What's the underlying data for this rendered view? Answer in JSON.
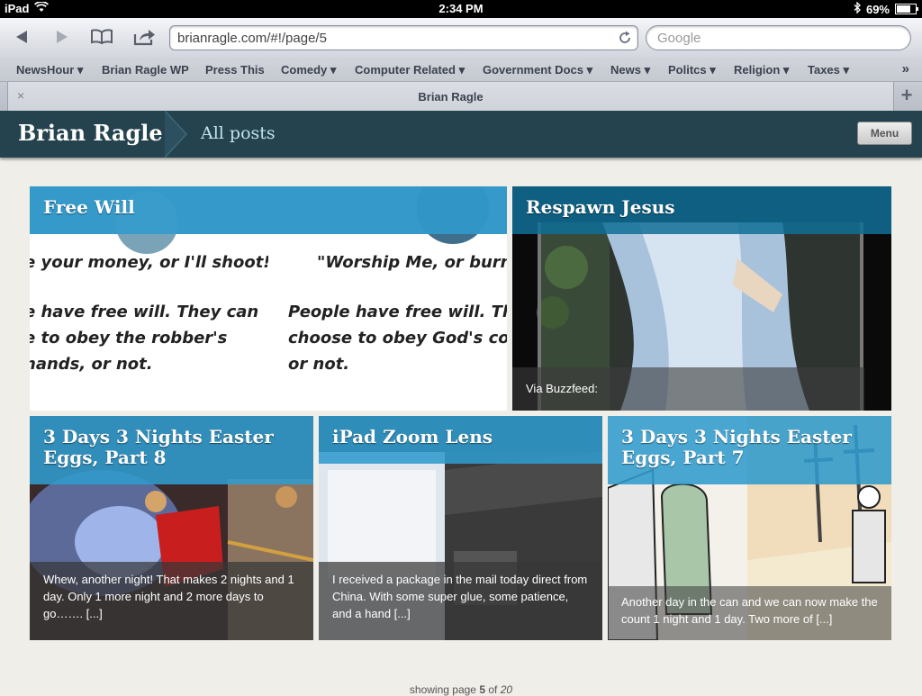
{
  "status_bar": {
    "device": "iPad",
    "time": "2:34 PM",
    "battery": "69%",
    "battery_level": 0.69
  },
  "browser": {
    "url": "brianragle.com/#!/page/5",
    "search_placeholder": "Google",
    "bookmarks": [
      {
        "label": "NewsHour ▾"
      },
      {
        "label": "Brian Ragle WP"
      },
      {
        "label": "Press This"
      },
      {
        "label": "Comedy ▾"
      },
      {
        "label": "Computer Related ▾"
      },
      {
        "label": "Government Docs ▾"
      },
      {
        "label": "News ▾"
      },
      {
        "label": "Politcs ▾"
      },
      {
        "label": "Religion ▾"
      },
      {
        "label": "Taxes ▾"
      }
    ],
    "bookmarks_more": "»",
    "tab_title": "Brian Ragle",
    "tab_close": "×",
    "tab_add": "+"
  },
  "site": {
    "brand": "Brian Ragle",
    "section": "All posts",
    "menu_label": "Menu"
  },
  "posts": [
    {
      "title": "Free Will",
      "excerpt": "",
      "thumb_text": {
        "col1": [
          "e your money, or I'll shoot!\"",
          "e have free will. They can",
          "e to obey the robber's",
          "nands, or not."
        ],
        "col2": [
          "\"Worship Me, or burn i",
          "People have free will. They",
          "choose to obey God's comn",
          "or not."
        ]
      }
    },
    {
      "title": "Respawn Jesus",
      "excerpt": "Via Buzzfeed:"
    },
    {
      "title": "3 Days 3 Nights Easter Eggs, Part 8",
      "excerpt": "Whew, another night!  That makes 2 nights and 1 day.  Only 1 more night and 2 more days to go……. [...]"
    },
    {
      "title": "iPad Zoom Lens",
      "excerpt": "I received a package in the mail today direct from China.  With some super glue, some patience, and a hand [...]"
    },
    {
      "title": "3 Days 3 Nights Easter Eggs, Part 7",
      "excerpt": "Another day in the can and we can now make the count 1 night and 1 day.  Two more of [...]"
    }
  ],
  "pager": {
    "prefix": "showing page",
    "current": "5",
    "of": "of",
    "total": "20"
  }
}
